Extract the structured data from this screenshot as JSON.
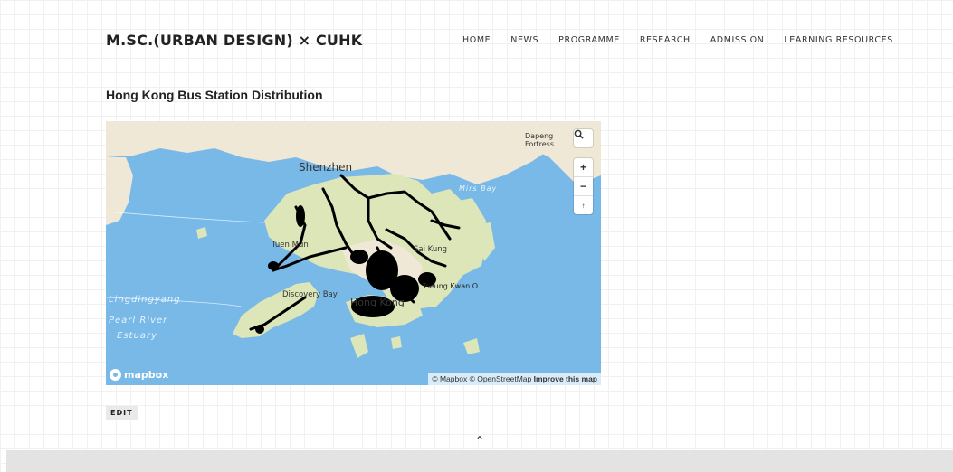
{
  "site": {
    "title": "M.SC.(URBAN DESIGN) × CUHK"
  },
  "nav": {
    "items": [
      {
        "label": "HOME"
      },
      {
        "label": "NEWS"
      },
      {
        "label": "PROGRAMME"
      },
      {
        "label": "RESEARCH"
      },
      {
        "label": "ADMISSION"
      },
      {
        "label": "LEARNING RESOURCES"
      }
    ]
  },
  "page": {
    "title": "Hong Kong Bus Station Distribution"
  },
  "map": {
    "labels": {
      "shenzhen": "Shenzhen",
      "dapeng": "Dapeng\nFortress",
      "mirs_bay": "Mirs Bay",
      "tuen_mun": "Tuen Mun",
      "sai_kung": "Sai Kung",
      "discovery_bay": "Discovery Bay",
      "hong_kong": "Hong Kong",
      "lingdingyang": "Lingdingyang",
      "pearl_river": "Pearl River",
      "estuary": "Estuary",
      "tseung_kwan_o": "Tseung Kwan O"
    },
    "controls": {
      "search_icon": "search-icon",
      "zoom_in": "+",
      "zoom_out": "−",
      "compass": "↑"
    },
    "logo_text": "mapbox",
    "attribution": {
      "mapbox": "© Mapbox",
      "osm": "© OpenStreetMap",
      "improve": "Improve this map"
    },
    "colors": {
      "water": "#78b9e8",
      "land": "#efe8d6",
      "park": "#dde6b8",
      "stations": "#000000"
    }
  },
  "actions": {
    "edit_label": "EDIT"
  },
  "footer": {
    "back_to_top": "⌃"
  }
}
